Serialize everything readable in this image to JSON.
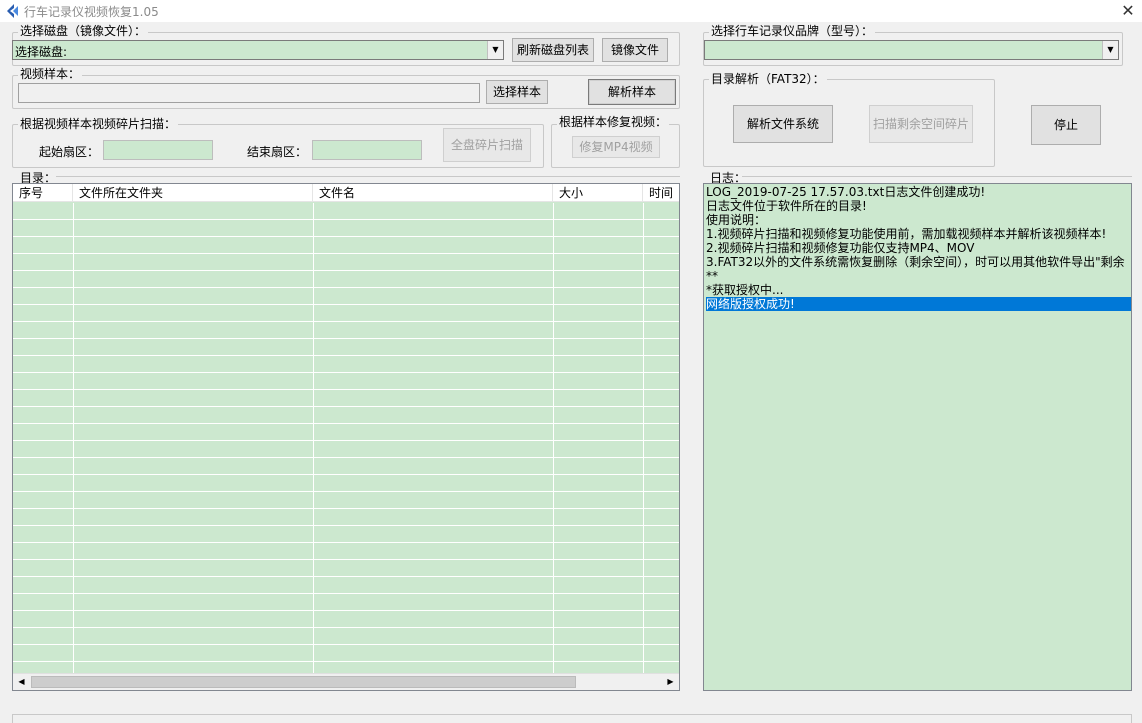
{
  "window": {
    "title": "行车记录仪视频恢复1.05",
    "close_glyph": "✕",
    "icon": "back-arrow-icon"
  },
  "disk_group": {
    "label": "选择磁盘（镜像文件）：",
    "combo_value": "选择磁盘:",
    "refresh_button": "刷新磁盘列表",
    "image_button": "镜像文件"
  },
  "sample_group": {
    "label": "视频样本：",
    "path_value": "",
    "select_button": "选择样本",
    "parse_button": "解析样本"
  },
  "scan_group": {
    "label": "根据视频样本视频碎片扫描：",
    "start_label": "起始扇区：",
    "start_value": "",
    "end_label": "结束扇区：",
    "end_value": "",
    "scan_button": "全盘碎片扫描"
  },
  "repair_group": {
    "label": "根据样本修复视频：",
    "repair_button": "修复MP4视频"
  },
  "brand_group": {
    "label": "选择行车记录仪品牌（型号）：",
    "combo_value": ""
  },
  "dir_parse_group": {
    "label": "目录解析（FAT32）：",
    "parse_fs_button": "解析文件系统",
    "scan_free_button": "扫描剩余空间碎片"
  },
  "stop_button": "停止",
  "directory": {
    "label": "目录：",
    "columns": [
      "序号",
      "文件所在文件夹",
      "文件名",
      "大小",
      "时间"
    ]
  },
  "log": {
    "label": "日志：",
    "lines": [
      "LOG_2019-07-25 17.57.03.txt日志文件创建成功!",
      "日志文件位于软件所在的目录!",
      "使用说明：",
      " 1.视频碎片扫描和视频修复功能使用前，需加载视频样本并解析该视频样本!",
      " 2.视频碎片扫描和视频修复功能仅支持MP4、MOV",
      " 3.FAT32以外的文件系统需恢复删除（剩余空间），时可以用其他软件导出\"剩余",
      "**",
      "*获取授权中...",
      "网络版授权成功!"
    ],
    "selected_index": 8
  }
}
